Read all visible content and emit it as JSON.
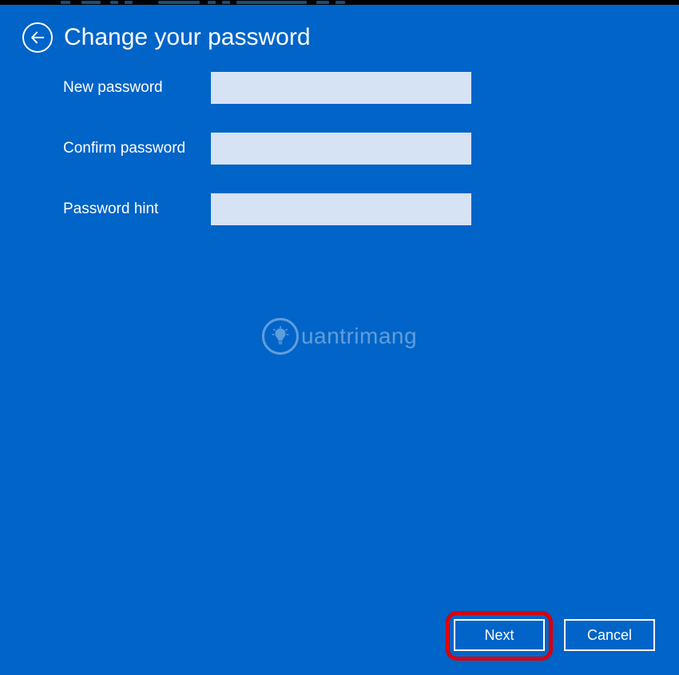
{
  "header": {
    "title": "Change your password"
  },
  "form": {
    "new_password": {
      "label": "New password",
      "value": ""
    },
    "confirm_password": {
      "label": "Confirm password",
      "value": ""
    },
    "password_hint": {
      "label": "Password hint",
      "value": ""
    }
  },
  "watermark": {
    "text": "uantrimang"
  },
  "footer": {
    "next_label": "Next",
    "cancel_label": "Cancel"
  }
}
